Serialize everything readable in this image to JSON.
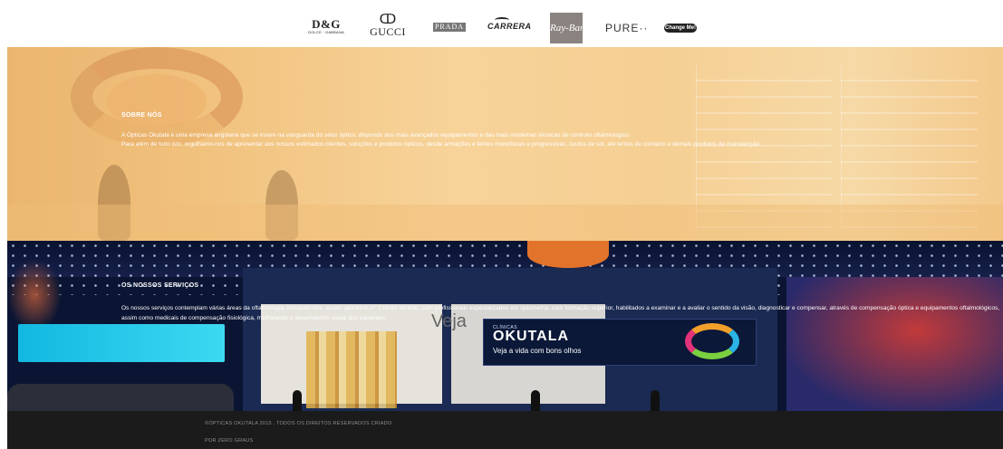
{
  "brands": {
    "dg": {
      "name": "D&G",
      "sub": "DOLCE · GABBANA"
    },
    "gucci": {
      "mark": "ↀ",
      "name": "GUCCI"
    },
    "prada": "PRADA",
    "carrera": "CARRERA",
    "rayban": "Ray-Ban",
    "pure": "PURE··",
    "change": "Change Me!"
  },
  "about": {
    "title": "SOBRE NÓS",
    "line1": "A Ópticas Okutala é uma empresa angolana que se insere na vanguarda do setor óptico, dispondo dos mais avançados equipamentos e das mais modernas técnicas de controlo oftalmológico.",
    "line2": "Para além de tudo isto, orgulhamo-nos de apresentar aos nossos estimados clientes, soluções e produtos ópticos, desde armações e lentes monofocais e progressivas, óculos de sol, até lentes de contacto e demais produtos de manutenção."
  },
  "services": {
    "title": "OS NOSSOS SERVIÇOS",
    "text": "Os nossos serviços contemplam várias áreas da oftalmologia, tornando-nos, assim, pioneiros n° 1 neste sentido, com profissionais especializados em optometria, com formação superior, habilitados a examinar e a avaliar o sentido da visão, diagnosticar e compensar, através de compensação óptica e equipamentos oftalmológicos, assim como medicais de compensação fisiológica, melhorando o desempenho visual dos pacientes."
  },
  "storefront": {
    "veja": "Veja",
    "clinic_small": "CLÍNICAS",
    "clinic_name": "OKUTALA",
    "tagline": "Veja a vida com bons olhos"
  },
  "footer": {
    "line1": "©ÓPTICAS OKUTALA 2015 . TODOS OS DIREITOS RESERVADOS CRIADO",
    "line2": "POR ZERO GRAUS"
  }
}
